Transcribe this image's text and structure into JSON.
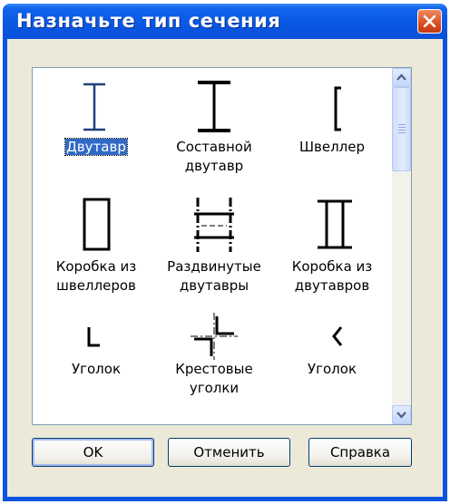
{
  "window": {
    "title": "Назначьте тип сечения"
  },
  "section_types": [
    {
      "label": "Двутавр",
      "icon": "i-beam-icon",
      "selected": true
    },
    {
      "label": "Составной двутавр",
      "icon": "composite-i-beam-icon",
      "selected": false
    },
    {
      "label": "Швеллер",
      "icon": "channel-icon",
      "selected": false
    },
    {
      "label": "Коробка из швеллеров",
      "icon": "channel-box-icon",
      "selected": false
    },
    {
      "label": "Раздвинутые двутавры",
      "icon": "spread-i-beams-icon",
      "selected": false
    },
    {
      "label": "Коробка из двутавров",
      "icon": "i-beam-box-icon",
      "selected": false
    },
    {
      "label": "Уголок",
      "icon": "angle-icon",
      "selected": false
    },
    {
      "label": "Крестовые уголки",
      "icon": "cross-angles-icon",
      "selected": false
    },
    {
      "label": "Уголок",
      "icon": "angle-rotated-icon",
      "selected": false
    }
  ],
  "buttons": {
    "ok": "OK",
    "cancel": "Отменить",
    "help": "Справка"
  },
  "colors": {
    "title_bar": "#0a55e0",
    "selection": "#316ac5",
    "dialog_bg": "#ece9d8",
    "selected_icon": "#1f3f7a"
  }
}
